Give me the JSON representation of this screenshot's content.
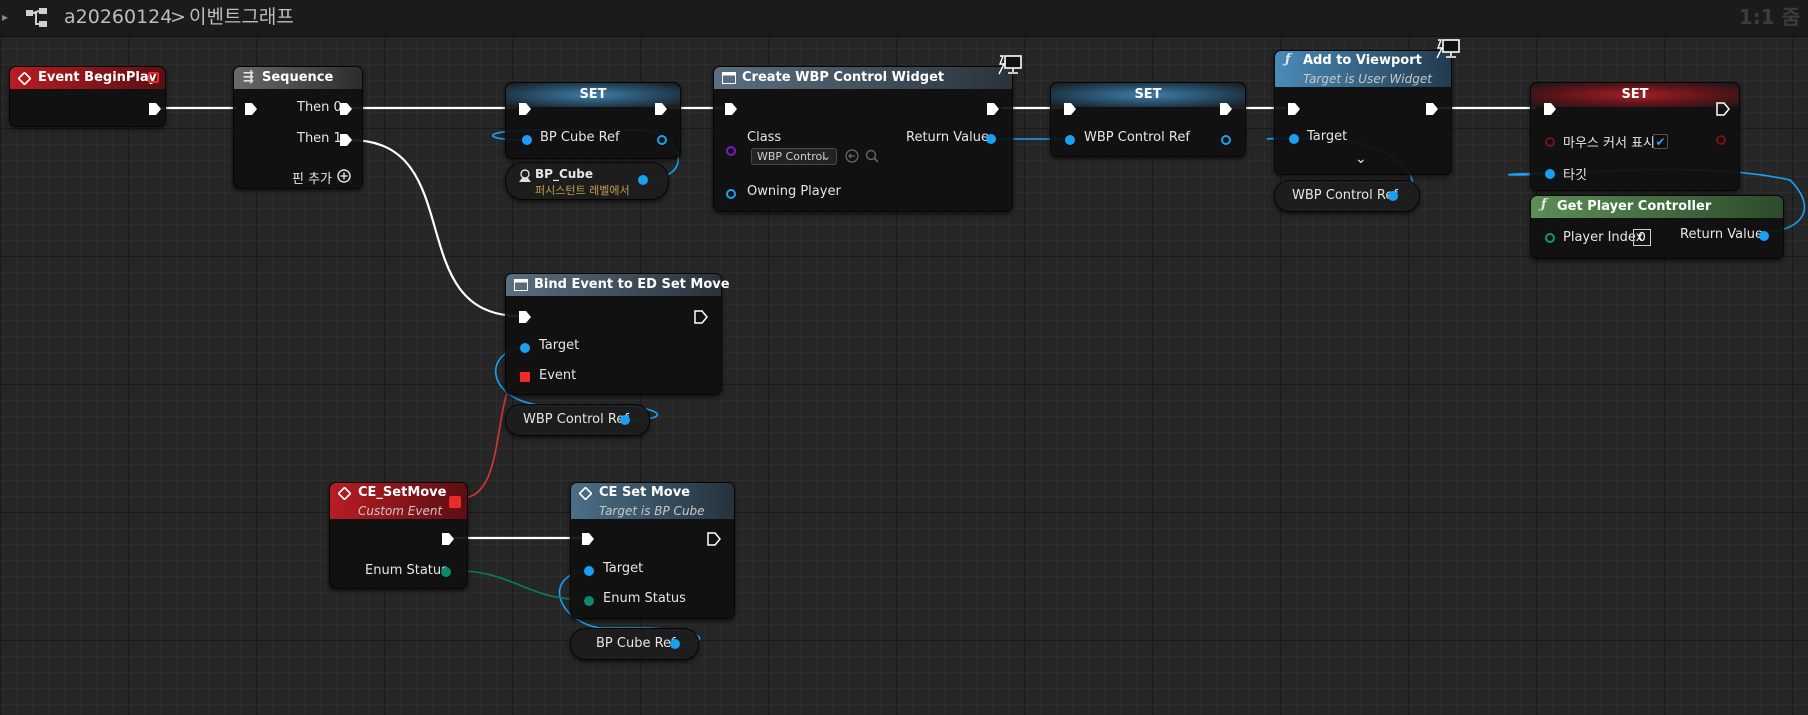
{
  "breadcrumb": {
    "project": "a20260124",
    "separator": ">",
    "graph": "이벤트그래프"
  },
  "zoom_label": "1:1 줌",
  "colors": {
    "exec_wire": "#ffffff",
    "object_wire": "#1aa0f0",
    "enum_wire": "#0a7a68",
    "delegate_wire": "#d8362e",
    "event_header": "#b91c24",
    "function_header": "#4b8bb8",
    "pure_header": "#5a8f55"
  },
  "nodes": {
    "begin_play": {
      "title": "Event BeginPlay"
    },
    "sequence": {
      "title": "Sequence",
      "then0": "Then 0",
      "then1": "Then 1",
      "add_pin": "핀 추가"
    },
    "set_cube": {
      "title": "SET",
      "pin": "BP Cube Ref"
    },
    "bp_cube": {
      "name": "BP_Cube",
      "subtitle": "퍼시스턴트 레벨에서"
    },
    "create_widget": {
      "title": "Create WBP Control Widget",
      "class_label": "Class",
      "class_value": "WBP Control",
      "owning_player": "Owning Player",
      "return_value": "Return Value"
    },
    "set_wbp": {
      "title": "SET",
      "pin": "WBP Control Ref"
    },
    "add_viewport": {
      "title": "Add to Viewport",
      "subtitle": "Target is User Widget",
      "target": "Target"
    },
    "var_wbp_1": {
      "label": "WBP Control Ref"
    },
    "set_cursor": {
      "title": "SET",
      "pin": "마우스 커서 표시",
      "target": "타깃",
      "checked": true
    },
    "get_pc": {
      "title": "Get Player Controller",
      "player_index": "Player Index",
      "index_value": "0",
      "return_value": "Return Value"
    },
    "bind_event": {
      "title": "Bind Event to ED Set Move",
      "target": "Target",
      "event": "Event"
    },
    "var_wbp_2": {
      "label": "WBP Control Ref"
    },
    "ce_setmove": {
      "title": "CE_SetMove",
      "subtitle": "Custom Event",
      "enum": "Enum Status"
    },
    "ce_set_move_call": {
      "title": "CE Set Move",
      "subtitle": "Target is BP Cube",
      "target": "Target",
      "enum": "Enum Status"
    },
    "var_cube": {
      "label": "BP Cube Ref"
    }
  }
}
